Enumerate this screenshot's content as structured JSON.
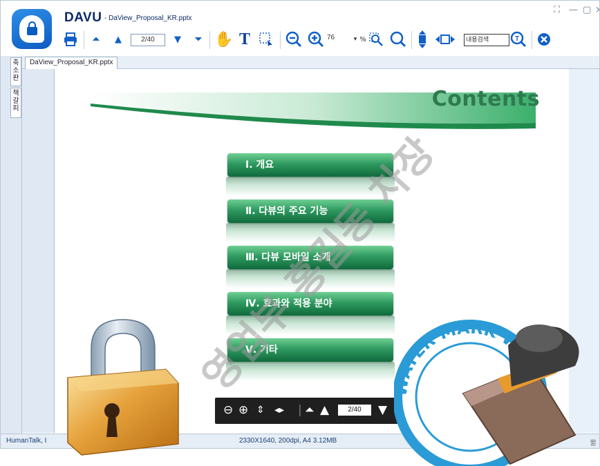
{
  "app": {
    "name": "DAVU",
    "file_title": "- DaView_Proposal_KR.pptx",
    "window_controls": [
      "[ ]",
      "—",
      "▢",
      "×"
    ]
  },
  "toolbar": {
    "page_indicator": "2/40",
    "zoom_value": "76",
    "zoom_unit": "%",
    "search_placeholder": "내용검색",
    "icons": [
      "print-icon",
      "first-page-icon",
      "prev-page-icon",
      "next-page-icon",
      "last-page-icon",
      "hand-tool-icon",
      "text-select-icon",
      "area-select-icon",
      "zoom-out-icon",
      "zoom-in-icon",
      "zoom-dropdown-icon",
      "zoom-area-icon",
      "magnifier-icon",
      "fit-height-icon",
      "fit-width-icon",
      "search-icon",
      "close-icon"
    ]
  },
  "side_tabs": {
    "thumbnails": "축소판",
    "bookmarks": "책갈피"
  },
  "doc_tab": {
    "label": "DaView_Proposal_KR.pptx"
  },
  "slide": {
    "heading": "Contents",
    "items": [
      "Ⅰ. 개요",
      "Ⅱ. 다뷰의 주요 기능",
      "Ⅲ. 다뷰 모바일 소개",
      "Ⅳ. 효과와 적용 분야",
      "Ⅴ. 기타"
    ],
    "watermark_text": "영업부 홍길동 차장"
  },
  "navbar": {
    "page_indicator": "2/40",
    "icons": [
      "zoom-out-icon",
      "zoom-in-icon",
      "fit-height-icon",
      "fit-width-icon",
      "first-page-icon",
      "prev-page-icon",
      "next-page-icon"
    ]
  },
  "status": {
    "left": "HumanTalk, I",
    "middle": "2330X1640, 200dpi, A4 3.12MB",
    "right": "뽦"
  },
  "stamp_text": "WATER MARK WATER MARK",
  "colors": {
    "brand_blue": "#1160c8",
    "heading_green": "#2f7a4f",
    "menu_green": "#2f9a60",
    "watermark_gray": "#9a9a9a",
    "stamp_blue": "#2a9bd6",
    "padlock_gold": "#e6a23c"
  }
}
